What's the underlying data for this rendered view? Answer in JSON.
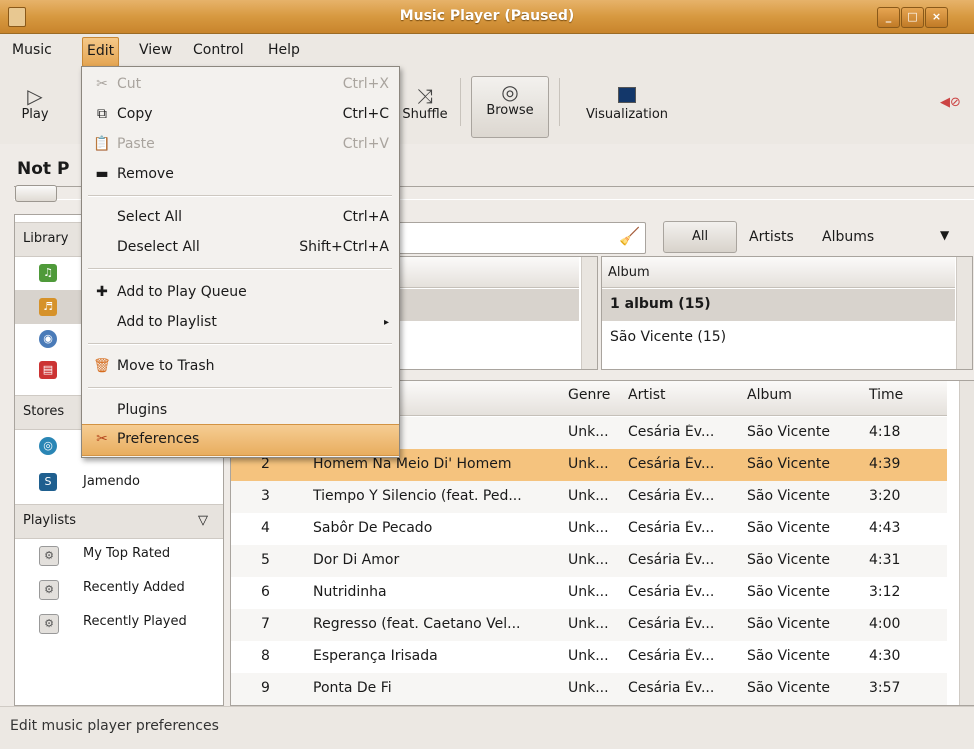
{
  "window": {
    "title": "Music Player (Paused)"
  },
  "menubar": [
    "Music",
    "Edit",
    "View",
    "Control",
    "Help"
  ],
  "toolbar": {
    "play": "Play",
    "shuffle": "Shuffle",
    "browse": "Browse",
    "visualization": "Visualization"
  },
  "now_playing": "Not P",
  "sidebar": {
    "library_header": "Library",
    "stores_header": "Stores",
    "playlists_header": "Playlists",
    "stores": [
      "Jamendo"
    ],
    "playlists": [
      "My Top Rated",
      "Recently Added",
      "Recently Played"
    ]
  },
  "filters": {
    "all": "All",
    "artists": "Artists",
    "albums": "Albums"
  },
  "album_pane": {
    "header": "Album",
    "summary": "1 album (15)",
    "albums": [
      "São Vicente (15)"
    ]
  },
  "tracklist": {
    "columns": {
      "genre": "Genre",
      "artist": "Artist",
      "album": "Album",
      "time": "Time"
    },
    "rows": [
      {
        "num": "",
        "title": "e Di Longe",
        "genre": "Unk...",
        "artist": "Cesária Év...",
        "album": "São Vicente",
        "time": "4:18"
      },
      {
        "num": "2",
        "title": "Homem Na Meio Di' Homem",
        "genre": "Unk...",
        "artist": "Cesária Év...",
        "album": "São Vicente",
        "time": "4:39"
      },
      {
        "num": "3",
        "title": "Tiempo Y Silencio (feat. Ped...",
        "genre": "Unk...",
        "artist": "Cesária Év...",
        "album": "São Vicente",
        "time": "3:20"
      },
      {
        "num": "4",
        "title": "Sabôr De Pecado",
        "genre": "Unk...",
        "artist": "Cesária Év...",
        "album": "São Vicente",
        "time": "4:43"
      },
      {
        "num": "5",
        "title": "Dor Di Amor",
        "genre": "Unk...",
        "artist": "Cesária Év...",
        "album": "São Vicente",
        "time": "4:31"
      },
      {
        "num": "6",
        "title": "Nutridinha",
        "genre": "Unk...",
        "artist": "Cesária Év...",
        "album": "São Vicente",
        "time": "3:12"
      },
      {
        "num": "7",
        "title": "Regresso (feat. Caetano Vel...",
        "genre": "Unk...",
        "artist": "Cesária Év...",
        "album": "São Vicente",
        "time": "4:00"
      },
      {
        "num": "8",
        "title": "Esperança Irisada",
        "genre": "Unk...",
        "artist": "Cesária Év...",
        "album": "São Vicente",
        "time": "4:30"
      },
      {
        "num": "9",
        "title": "Ponta De Fi",
        "genre": "Unk...",
        "artist": "Cesária Év...",
        "album": "São Vicente",
        "time": "3:57"
      }
    ]
  },
  "edit_menu": {
    "cut": "Cut",
    "cut_acc": "Ctrl+X",
    "copy": "Copy",
    "copy_acc": "Ctrl+C",
    "paste": "Paste",
    "paste_acc": "Ctrl+V",
    "remove": "Remove",
    "select_all": "Select All",
    "select_all_acc": "Ctrl+A",
    "deselect_all": "Deselect All",
    "deselect_all_acc": "Shift+Ctrl+A",
    "add_queue": "Add to Play Queue",
    "add_playlist": "Add to Playlist",
    "trash": "Move to Trash",
    "plugins": "Plugins",
    "preferences": "Preferences"
  },
  "status": "Edit music player preferences"
}
